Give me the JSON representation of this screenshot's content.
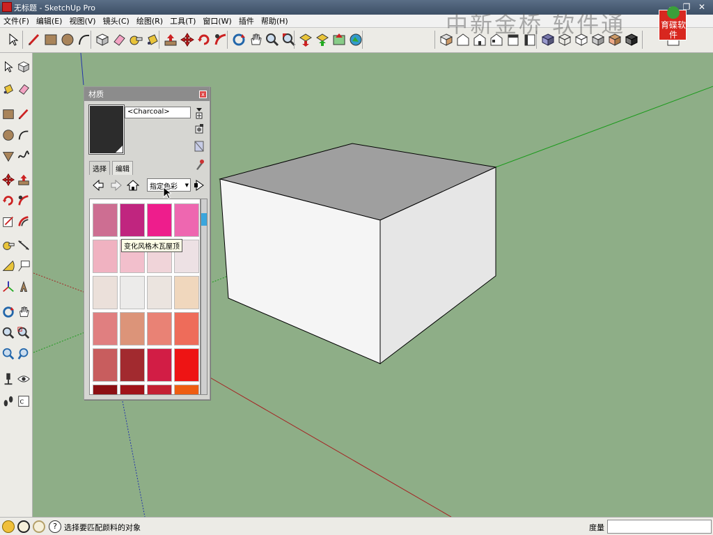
{
  "titlebar": {
    "title": "无标题 - SketchUp Pro",
    "minimize_glyph": "–",
    "restore_glyph": "❐",
    "close_glyph": "✕"
  },
  "watermark": {
    "text": "中新金桥 软件通",
    "logo_text": "育碟软件"
  },
  "menu": [
    {
      "label": "文件(F)"
    },
    {
      "label": "编辑(E)"
    },
    {
      "label": "视图(V)"
    },
    {
      "label": "镜头(C)"
    },
    {
      "label": "绘图(R)"
    },
    {
      "label": "工具(T)"
    },
    {
      "label": "窗口(W)"
    },
    {
      "label": "插件"
    },
    {
      "label": "帮助(H)"
    }
  ],
  "toolbar_icons": [
    "select-icon",
    "pencil-icon",
    "rectangle-icon",
    "circle-icon",
    "arc-icon",
    "make-component-icon",
    "eraser-icon",
    "tape-measure-icon",
    "paint-bucket-icon",
    "push-pull-icon",
    "move-icon",
    "rotate-icon",
    "follow-me-icon",
    "orbit-icon",
    "pan-icon",
    "zoom-icon",
    "zoom-extents-icon",
    "get-models-icon",
    "share-model-icon",
    "add-location-icon",
    "toggle-terrain-icon",
    "iso-view-icon",
    "top-view-icon",
    "front-view-icon",
    "right-view-icon",
    "back-view-icon",
    "left-view-icon",
    "xray-icon",
    "wireframe-icon",
    "hidden-line-icon",
    "shaded-icon",
    "shaded-textures-icon",
    "monochrome-icon",
    "section-icon"
  ],
  "side_icons": [
    "select-icon",
    "make-component-icon",
    "paint-bucket-icon",
    "eraser-icon",
    "rectangle-icon",
    "line-icon",
    "circle-icon",
    "arc-icon",
    "polygon-icon",
    "freehand-icon",
    "move-icon",
    "push-pull-icon",
    "rotate-icon",
    "follow-me-icon",
    "scale-icon",
    "offset-icon",
    "tape-measure-icon",
    "dimension-icon",
    "protractor-icon",
    "text-icon",
    "axes-icon",
    "3d-text-icon",
    "orbit-icon",
    "pan-icon",
    "zoom-icon",
    "zoom-window-icon",
    "previous-view-icon",
    "next-view-icon",
    "position-camera-icon",
    "look-around-icon",
    "walk-icon",
    "section-plane-icon"
  ],
  "status": {
    "icons": [
      "geo-location-icon",
      "credits-icon",
      "user-icon",
      "help-icon"
    ],
    "text": "选择要匹配颜料的对象",
    "measure_label": "度量",
    "measure_value": ""
  },
  "panel": {
    "title": "材质",
    "close_glyph": "x",
    "material_name": "<Charcoal>",
    "material_color": "#2c2c2c",
    "tabs": [
      {
        "label": "选择"
      },
      {
        "label": "编辑"
      }
    ],
    "dropdown": "指定色彩",
    "tooltip": "变化风格木瓦屋顶",
    "swatches": [
      "#cd6e92",
      "#c0257f",
      "#ee1d8c",
      "#ee67b0",
      "#f0b2c1",
      "#f2bfcc",
      "#f0d4d9",
      "#ede1e4",
      "#ebe0da",
      "#ecebea",
      "#ebe4df",
      "#f0d7bd",
      "#e07f80",
      "#dc9479",
      "#e98275",
      "#ee6c5a",
      "#c85d5e",
      "#a22a2f",
      "#d21d45",
      "#ee1414",
      "#8c0f13",
      "#a11319",
      "#c42033",
      "#ee5d12"
    ]
  },
  "canvas": {
    "background": "#8eae87",
    "box_top_color": "#9f9f9f",
    "box_front_color": "#f5f5f5",
    "box_side_color": "#e6e6e6"
  }
}
